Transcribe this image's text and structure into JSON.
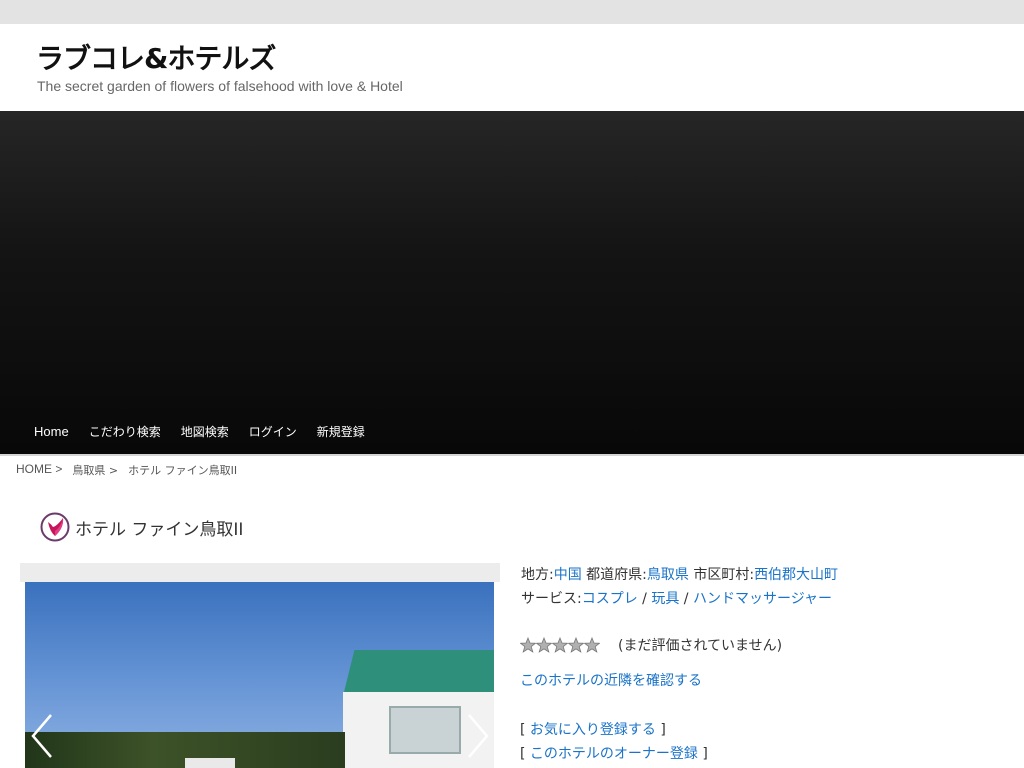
{
  "site": {
    "title": "ラブコレ&ホテルズ",
    "tagline": "The secret garden of flowers of falsehood with love & Hotel"
  },
  "nav": {
    "items": [
      {
        "label": "Home"
      },
      {
        "label": "こだわり検索"
      },
      {
        "label": "地図検索"
      },
      {
        "label": "ログイン"
      },
      {
        "label": "新規登録"
      }
    ]
  },
  "breadcrumb": {
    "home": "HOME",
    "sep": ">",
    "prefecture": "鳥取県",
    "current": "ホテル ファイン鳥取II"
  },
  "hotel": {
    "title": "ホテル ファイン鳥取II",
    "region_label": "地方:",
    "region": "中国",
    "pref_label": "都道府県:",
    "pref": "鳥取県",
    "city_label": "市区町村:",
    "city": "西伯郡大山町",
    "service_label": "サービス:",
    "services": [
      "コスプレ",
      "玩具",
      "ハンドマッサージャー"
    ],
    "service_sep": "/",
    "rating_text": "(まだ評価されていません)",
    "rating_value": 0,
    "rating_max": 5,
    "nearby_link": "このホテルの近隣を確認する",
    "bracket_open": "[",
    "bracket_close": "]",
    "favorite_link": "お気に入り登録する",
    "owner_link": "このホテルのオーナー登録"
  },
  "colors": {
    "link": "#1a73c8",
    "hero_dark": "#0a0a0a",
    "roof": "#2e8f7a"
  }
}
